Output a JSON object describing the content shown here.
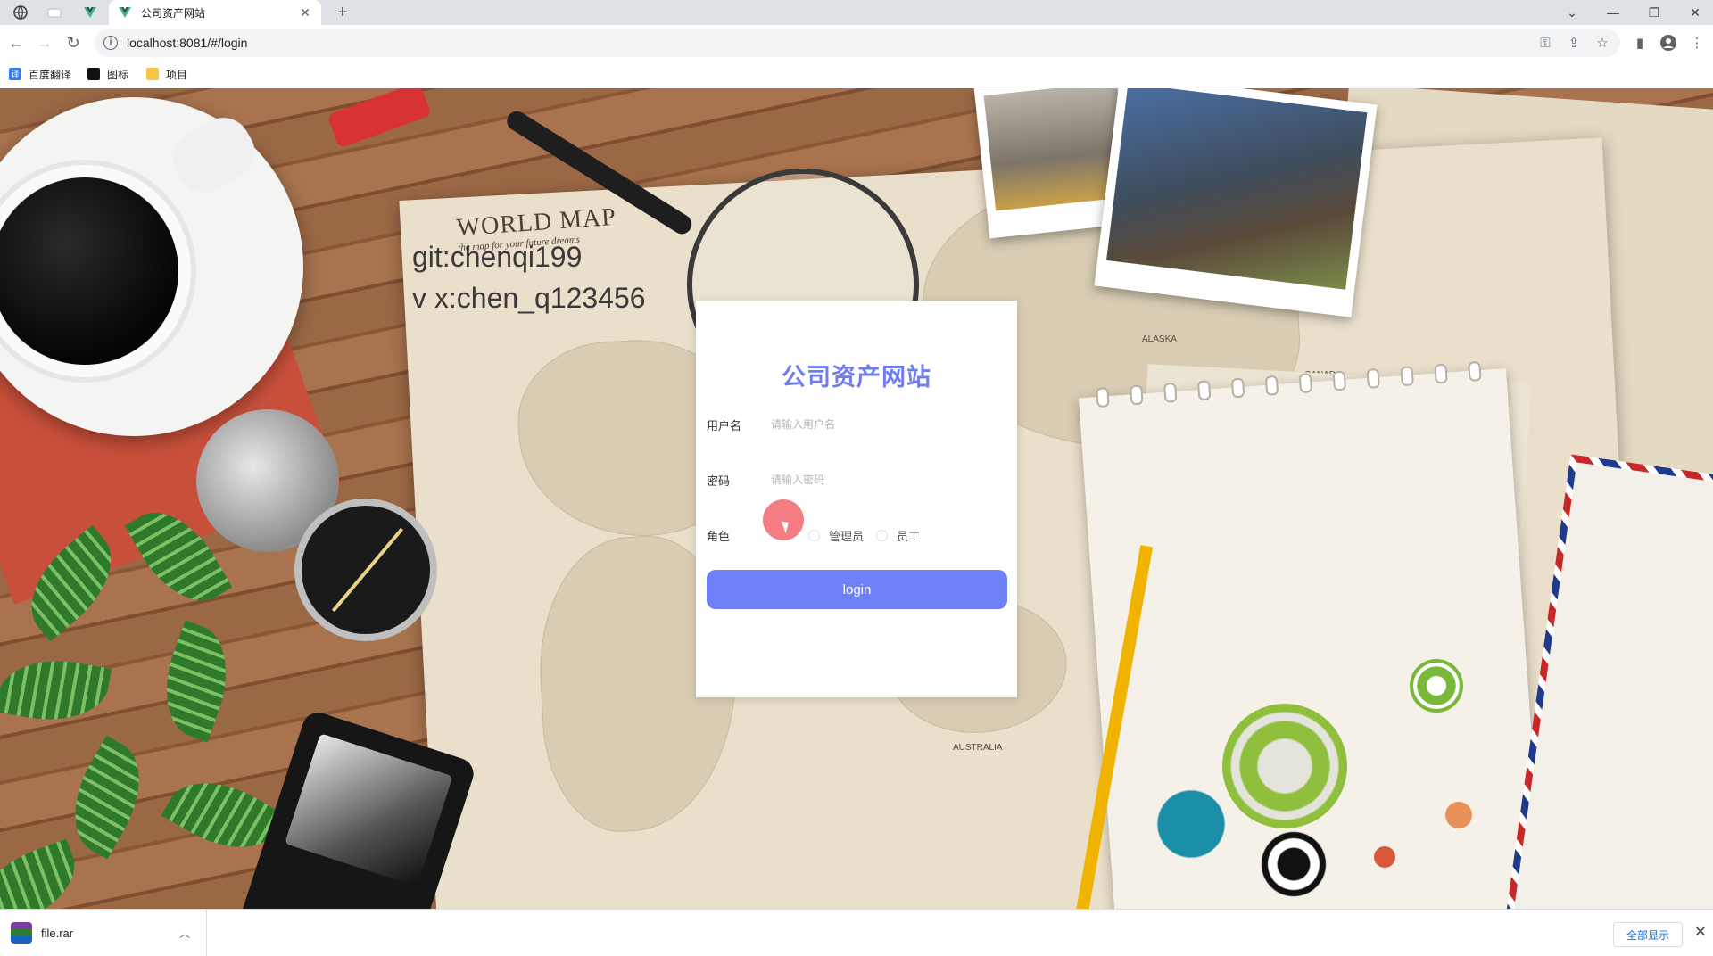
{
  "browser": {
    "tab_title": "公司资产网站",
    "url": "localhost:8081/#/login",
    "bookmarks": [
      "百度翻译",
      "图标",
      "项目"
    ]
  },
  "watermark": {
    "line1": "git:chenqi199",
    "line2": "v x:chen_q123456"
  },
  "map_text": {
    "title": "WORLD MAP",
    "subtitle": "the map for your future dreams",
    "canada": "CANADA",
    "alaska": "ALASKA",
    "australia": "AUSTRALIA"
  },
  "login": {
    "title": "公司资产网站",
    "username_label": "用户名",
    "username_placeholder": "请输入用户名",
    "password_label": "密码",
    "password_placeholder": "请输入密码",
    "role_label": "角色",
    "roles": [
      "管理员",
      "员工"
    ],
    "submit_label": "login"
  },
  "download_bar": {
    "file_name": "file.rar",
    "show_all_label": "全部显示"
  },
  "colors": {
    "accent": "#6e80f5",
    "title": "#6e7cf0"
  }
}
